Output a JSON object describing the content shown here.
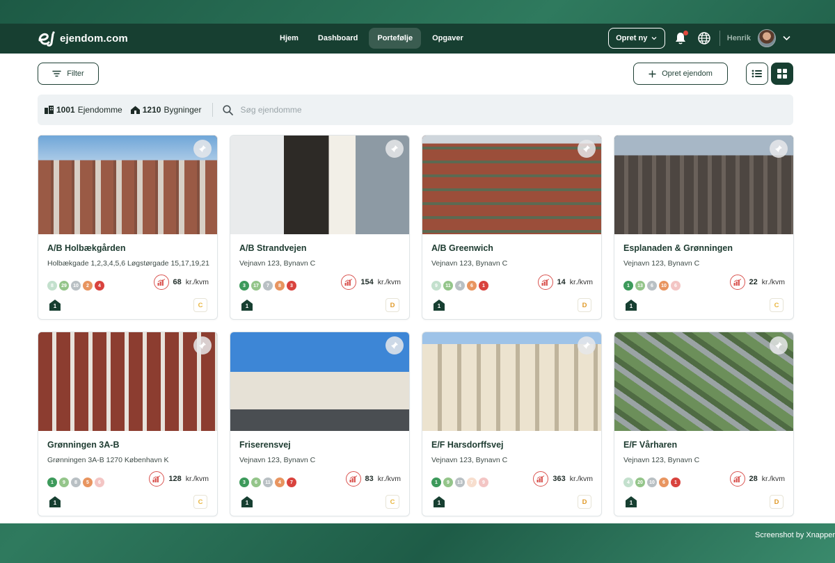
{
  "app": {
    "logo_text": "ejendom.com"
  },
  "nav": [
    {
      "label": "Hjem",
      "active": false
    },
    {
      "label": "Dashboard",
      "active": false
    },
    {
      "label": "Portefølje",
      "active": true
    },
    {
      "label": "Opgaver",
      "active": false
    }
  ],
  "header": {
    "create_new_label": "Opret ny",
    "user_name": "Henrik"
  },
  "toolbar": {
    "filter_label": "Filter",
    "create_property_label": "Opret ejendom"
  },
  "stats": {
    "properties_count": "1001",
    "properties_label": "Ejendomme",
    "buildings_count": "1210",
    "buildings_label": "Bygninger",
    "search_placeholder": "Søg ejendomme"
  },
  "status_colors": [
    "#3d9a5b",
    "#94c58a",
    "#b9c0c4",
    "#e89560",
    "#d9433e"
  ],
  "properties": [
    {
      "name": "A/B Holbækgården",
      "address": "Holbækgade 1,2,3,4,5,6 Løgstørgade 15,17,19,21",
      "counts": [
        "8",
        "29",
        "10",
        "2",
        "4"
      ],
      "faded": [
        true,
        false,
        false,
        false,
        false
      ],
      "price": "68",
      "unit": "kr./kvm",
      "buildings": "1",
      "energy": "C",
      "energy_color": "#e9b640",
      "photo": "brick-tall"
    },
    {
      "name": "A/B Strandvejen",
      "address": "Vejnavn 123, Bynavn C",
      "counts": [
        "3",
        "17",
        "7",
        "8",
        "3"
      ],
      "faded": [
        false,
        false,
        false,
        false,
        false
      ],
      "price": "154",
      "unit": "kr./kvm",
      "buildings": "1",
      "energy": "D",
      "energy_color": "#e09a2a",
      "photo": "shop-front"
    },
    {
      "name": "A/B Greenwich",
      "address": "Vejnavn 123, Bynavn C",
      "counts": [
        "9",
        "11",
        "4",
        "6",
        "1"
      ],
      "faded": [
        true,
        false,
        false,
        false,
        false
      ],
      "price": "14",
      "unit": "kr./kvm",
      "buildings": "1",
      "energy": "D",
      "energy_color": "#e09a2a",
      "photo": "brick-balcony"
    },
    {
      "name": "Esplanaden & Grønningen",
      "address": "Vejnavn 123, Bynavn C",
      "counts": [
        "1",
        "13",
        "6",
        "10",
        "6"
      ],
      "faded": [
        false,
        false,
        false,
        false,
        true
      ],
      "price": "22",
      "unit": "kr./kvm",
      "buildings": "1",
      "energy": "C",
      "energy_color": "#e9b640",
      "photo": "grand-facade"
    },
    {
      "name": "Grønningen 3A-B",
      "address": "Grønningen 3A-B 1270 København K",
      "counts": [
        "1",
        "9",
        "8",
        "5",
        "6"
      ],
      "faded": [
        false,
        false,
        false,
        false,
        true
      ],
      "price": "128",
      "unit": "kr./kvm",
      "buildings": "1",
      "energy": "C",
      "energy_color": "#e9b640",
      "photo": "brick-red"
    },
    {
      "name": "Friserensvej",
      "address": "Vejnavn 123, Bynavn C",
      "counts": [
        "3",
        "6",
        "11",
        "4",
        "7"
      ],
      "faded": [
        false,
        false,
        false,
        false,
        false
      ],
      "price": "83",
      "unit": "kr./kvm",
      "buildings": "1",
      "energy": "C",
      "energy_color": "#e9b640",
      "photo": "street-white"
    },
    {
      "name": "E/F Harsdorffsvej",
      "address": "Vejnavn 123, Bynavn C",
      "counts": [
        "1",
        "9",
        "13",
        "7",
        "9"
      ],
      "faded": [
        false,
        false,
        false,
        true,
        true
      ],
      "price": "363",
      "unit": "kr./kvm",
      "buildings": "1",
      "energy": "D",
      "energy_color": "#e09a2a",
      "photo": "cream-facade"
    },
    {
      "name": "E/F Vårharen",
      "address": "Vejnavn 123, Bynavn C",
      "counts": [
        "4",
        "20",
        "10",
        "6",
        "1"
      ],
      "faded": [
        true,
        false,
        false,
        false,
        false
      ],
      "price": "28",
      "unit": "kr./kvm",
      "buildings": "1",
      "energy": "D",
      "energy_color": "#e09a2a",
      "photo": "aerial"
    }
  ],
  "footer_note": "Screenshot by Xnapper"
}
